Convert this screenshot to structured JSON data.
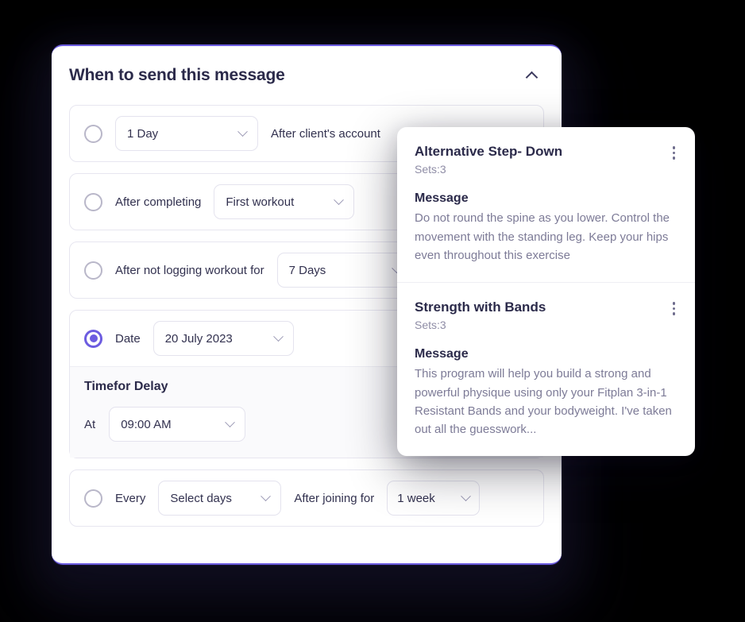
{
  "card": {
    "title": "When to send this message",
    "collapse_icon": "chevron-up-icon"
  },
  "options": [
    {
      "id": "account-created",
      "selected": false,
      "select_value": "1 Day",
      "trailing_label": "After client's account"
    },
    {
      "id": "after-completing",
      "selected": false,
      "leading_label": "After completing",
      "select_value": "First workout"
    },
    {
      "id": "not-logging",
      "selected": false,
      "leading_label": "After not logging workout for",
      "select_value": "7 Days"
    },
    {
      "id": "date",
      "selected": true,
      "leading_label": "Date",
      "select_value": "20 July 2023",
      "delay": {
        "title": "Timefor Delay",
        "at_label": "At",
        "time_value": "09:00 AM"
      }
    },
    {
      "id": "every",
      "selected": false,
      "leading_label": "Every",
      "select_value": "Select days",
      "mid_label": "After joining for",
      "select_value_2": "1 week"
    }
  ],
  "overlay": {
    "cards": [
      {
        "title": "Alternative Step- Down",
        "sets": "Sets:3",
        "message_label": "Message",
        "message_text": "Do not round the spine as you lower. Control the movement with the standing leg. Keep your hips even throughout this exercise",
        "menu_icon": "kebab-menu-icon"
      },
      {
        "title": "Strength with Bands",
        "sets": "Sets:3",
        "message_label": "Message",
        "message_text": "This program will help you build a strong and powerful physique using only your Fitplan 3-in-1 Resistant Bands and your bodyweight. I've taken out all the guesswork...",
        "menu_icon": "kebab-menu-icon"
      }
    ]
  },
  "colors": {
    "accent": "#6C5CE0",
    "title_text": "#2b2a4a",
    "body_text": "#7d7b97",
    "muted_text": "#8f8da6",
    "border": "#e7e6f0",
    "background": "#000000"
  }
}
